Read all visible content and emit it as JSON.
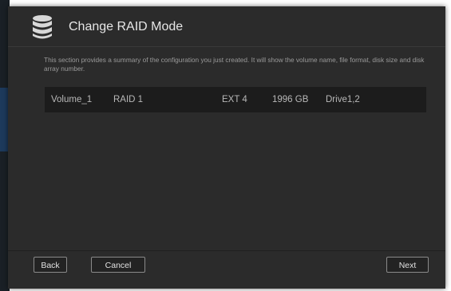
{
  "dialog": {
    "title": "Change RAID Mode",
    "description": "This section provides a summary of the configuration you just created. It will show the volume name, file format, disk size and disk array number.",
    "header_icon": "database-icon"
  },
  "summary": {
    "row": {
      "volume_name": "Volume_1",
      "raid_mode": "RAID 1",
      "file_format": "EXT 4",
      "disk_size": "1996 GB",
      "disk_array": "Drive1,2"
    }
  },
  "footer": {
    "back_label": "Back",
    "cancel_label": "Cancel",
    "next_label": "Next"
  },
  "colors": {
    "dialog_background": "#2b2b2b",
    "table_row_background": "#1c1c1c",
    "title_text": "#e6e6e6",
    "body_text": "#9a9a9a"
  }
}
